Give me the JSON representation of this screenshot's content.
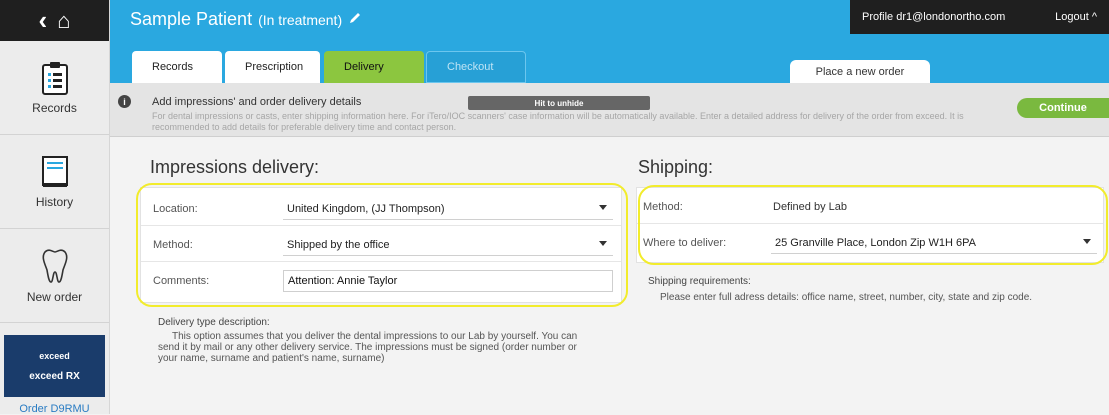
{
  "sidebar": {
    "top_icons": {
      "back": "‹",
      "home": "⌂"
    },
    "items": [
      {
        "label": "Records",
        "icon": "clipboard-icon"
      },
      {
        "label": "History",
        "icon": "book-icon"
      },
      {
        "label": "New order",
        "icon": "tooth-icon"
      }
    ],
    "exceed_label": "exceed",
    "exceed_rx_label": "exceed RX",
    "order_label": "Order D9RMU"
  },
  "header": {
    "patient_name": "Sample Patient",
    "patient_status": "(In treatment)",
    "edit_icon": "pencil-icon",
    "profile_text": "Profile dr1@londonortho.com",
    "logout_label": "Logout ^"
  },
  "tabs": [
    {
      "label": "Records"
    },
    {
      "label": "Prescription"
    },
    {
      "label": "Delivery"
    },
    {
      "label": "Checkout"
    }
  ],
  "place_order_label": "Place a new order",
  "banner": {
    "title": "Add impressions' and order delivery details",
    "text": "For dental impressions or casts, enter shipping information here. For iTero/IOC scanners' case information will be automatically available. Enter a detailed address for delivery of the order from exceed. It is recommended to add details for preferable delivery time and contact person.",
    "tooltip": "Hit to unhide",
    "continue_label": "Continue"
  },
  "impressions": {
    "title": "Impressions delivery:",
    "location_label": "Location:",
    "location_value": "United Kingdom, (JJ Thompson)",
    "method_label": "Method:",
    "method_value": "Shipped by the office",
    "comments_label": "Comments:",
    "comments_value": "Attention: Annie Taylor",
    "description_title": "Delivery type description:",
    "description_text": "This option assumes that you deliver the dental impressions to our Lab by yourself. You can send it by mail or any other delivery service. The impressions must be signed (order number or your name, surname and patient's name, surname)"
  },
  "shipping": {
    "title": "Shipping:",
    "method_label": "Method:",
    "method_value": "Defined by Lab",
    "where_label": "Where to deliver:",
    "where_value": "25 Granville Place, London Zip W1H 6PA",
    "requirements_title": "Shipping requirements:",
    "requirements_text": "Please enter full adress details: office name, street, number, city, state and zip code."
  },
  "colors": {
    "header_blue": "#2aa8e0",
    "active_tab_green": "#8cc63f",
    "continue_green": "#7ab93f",
    "highlight_yellow": "#f2ec2c"
  }
}
